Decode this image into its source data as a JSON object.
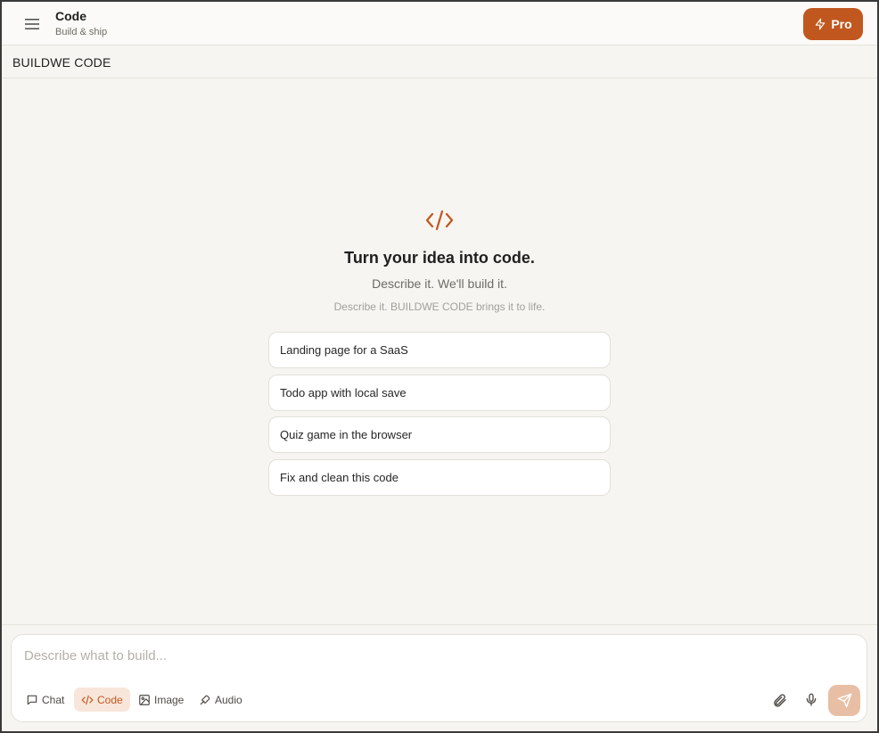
{
  "header": {
    "title": "Code",
    "subtitle": "Build & ship",
    "pro_label": "Pro"
  },
  "brand": "BUILDWE CODE",
  "hero": {
    "icon": "code-icon",
    "title": "Turn your idea into code.",
    "subtitle": "Describe it. We'll build it.",
    "note": "Describe it. BUILDWE CODE brings it to life."
  },
  "suggestions": [
    "Landing page for a SaaS",
    "Todo app with local save",
    "Quiz game in the browser",
    "Fix and clean this code"
  ],
  "composer": {
    "placeholder": "Describe what to build...",
    "modes": [
      {
        "label": "Chat",
        "icon": "chat-icon",
        "active": false
      },
      {
        "label": "Code",
        "icon": "code-icon",
        "active": true
      },
      {
        "label": "Image",
        "icon": "image-icon",
        "active": false
      },
      {
        "label": "Audio",
        "icon": "audio-icon",
        "active": false
      }
    ],
    "attach_icon": "paperclip-icon",
    "mic_icon": "microphone-icon",
    "send_icon": "send-icon"
  },
  "colors": {
    "accent": "#c0571f",
    "background": "#f6f5f1",
    "active_mode_bg": "#f8e6da",
    "send_disabled": "#e8bfa5"
  }
}
